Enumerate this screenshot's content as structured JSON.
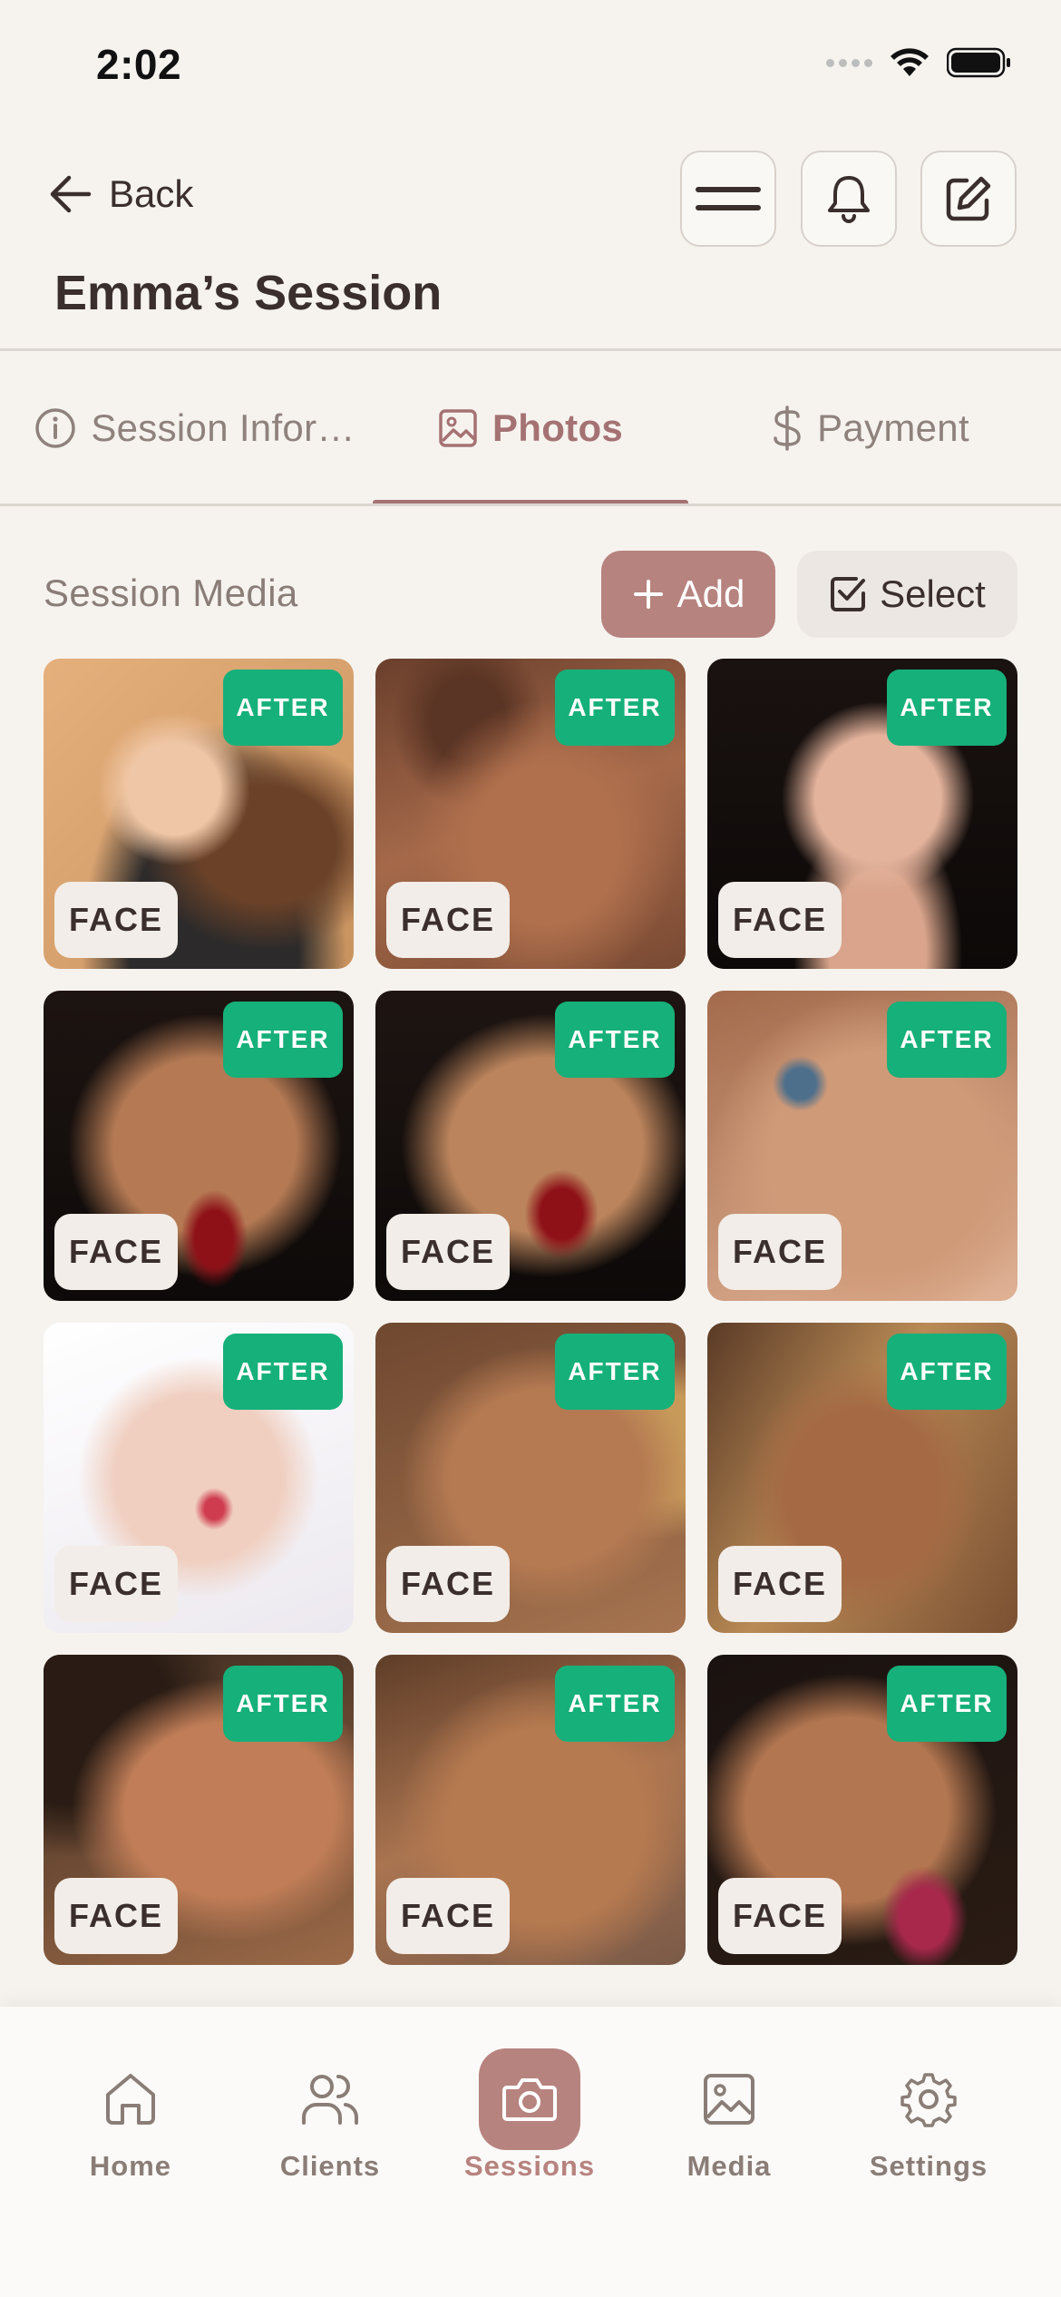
{
  "status_bar": {
    "time": "2:02"
  },
  "header": {
    "back_label": "Back",
    "title": "Emma’s Session",
    "icons": [
      "menu-icon",
      "bell-icon",
      "edit-icon"
    ]
  },
  "tabs": [
    {
      "label": "Session Infor…",
      "icon": "info-icon",
      "active": false
    },
    {
      "label": "Photos",
      "icon": "image-icon",
      "active": true
    },
    {
      "label": "Payment",
      "icon": "dollar-icon",
      "active": false
    }
  ],
  "media": {
    "title": "Session Media",
    "add_label": "Add",
    "select_label": "Select",
    "photos": [
      {
        "tag": "AFTER",
        "category": "FACE"
      },
      {
        "tag": "AFTER",
        "category": "FACE"
      },
      {
        "tag": "AFTER",
        "category": "FACE"
      },
      {
        "tag": "AFTER",
        "category": "FACE"
      },
      {
        "tag": "AFTER",
        "category": "FACE"
      },
      {
        "tag": "AFTER",
        "category": "FACE"
      },
      {
        "tag": "AFTER",
        "category": "FACE"
      },
      {
        "tag": "AFTER",
        "category": "FACE"
      },
      {
        "tag": "AFTER",
        "category": "FACE"
      },
      {
        "tag": "AFTER",
        "category": "FACE"
      },
      {
        "tag": "AFTER",
        "category": "FACE"
      },
      {
        "tag": "AFTER",
        "category": "FACE"
      }
    ]
  },
  "nav": [
    {
      "label": "Home",
      "icon": "home-icon",
      "active": false
    },
    {
      "label": "Clients",
      "icon": "users-icon",
      "active": false
    },
    {
      "label": "Sessions",
      "icon": "camera-icon",
      "active": true
    },
    {
      "label": "Media",
      "icon": "image-icon",
      "active": false
    },
    {
      "label": "Settings",
      "icon": "gear-icon",
      "active": false
    }
  ],
  "colors": {
    "accent": "#b7837f",
    "tab_active": "#a57273",
    "after_badge": "#16b07a",
    "background": "#f6f3ef"
  }
}
